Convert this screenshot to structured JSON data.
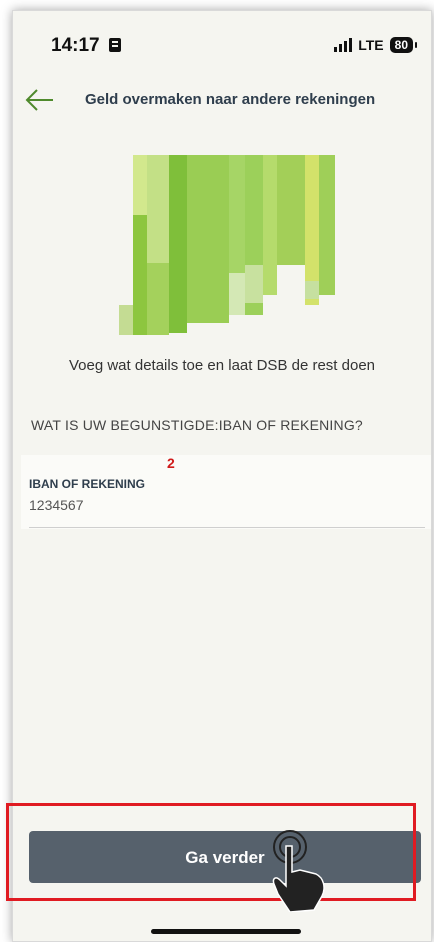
{
  "status_bar": {
    "time": "14:17",
    "network": "LTE",
    "battery": "80"
  },
  "header": {
    "title": "Geld overmaken naar andere rekeningen",
    "back_icon": "arrow-left-icon"
  },
  "hero": {
    "description": "green and lime vertical bar illustration",
    "colors": [
      "#8dc63f",
      "#a7d65a",
      "#c9e28a",
      "#d8e6a8",
      "#b5d36f"
    ]
  },
  "tagline": "Voeg wat details toe en laat DSB de rest doen",
  "section_label": "WAT IS UW BEGUNSTIGDE:IBAN OF REKENING?",
  "iban_field": {
    "step_marker": "2",
    "label": "IBAN OF REKENING",
    "value": "1234567"
  },
  "actions": {
    "continue_label": "Ga verder"
  },
  "colors": {
    "accent": "#4f8a2c",
    "button": "#56616c",
    "highlight": "#e01b22"
  }
}
